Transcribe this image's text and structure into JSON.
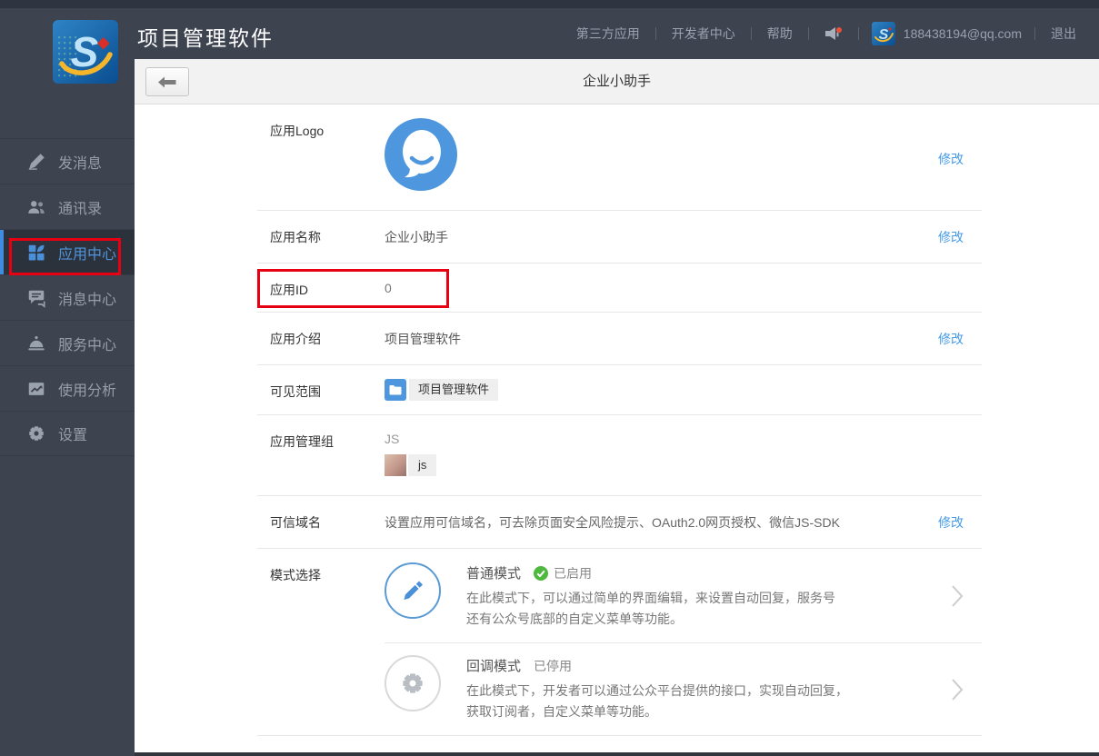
{
  "brand": {
    "app_title": "项目管理软件",
    "logo_letter": "S"
  },
  "topnav": {
    "third_party": "第三方应用",
    "developer_center": "开发者中心",
    "help": "帮助",
    "email": "188438194@qq.com",
    "logout": "退出"
  },
  "sidebar": {
    "items": [
      {
        "label": "发消息",
        "icon": "compose-icon",
        "active": false
      },
      {
        "label": "通讯录",
        "icon": "contacts-icon",
        "active": false
      },
      {
        "label": "应用中心",
        "icon": "apps-icon",
        "active": true,
        "annotation": "red-box"
      },
      {
        "label": "消息中心",
        "icon": "chat-icon",
        "active": false
      },
      {
        "label": "服务中心",
        "icon": "service-bell-icon",
        "active": false
      },
      {
        "label": "使用分析",
        "icon": "analytics-icon",
        "active": false
      },
      {
        "label": "设置",
        "icon": "gear-icon",
        "active": false
      }
    ]
  },
  "page": {
    "title": "企业小助手"
  },
  "form": {
    "logo": {
      "label": "应用Logo",
      "action": "修改"
    },
    "name": {
      "label": "应用名称",
      "value": "企业小助手",
      "action": "修改"
    },
    "app_id": {
      "label": "应用ID",
      "value": "0",
      "annotation": "red-box"
    },
    "intro": {
      "label": "应用介绍",
      "value": "项目管理软件",
      "action": "修改"
    },
    "scope": {
      "label": "可见范围",
      "tag": "项目管理软件"
    },
    "admin_group": {
      "label": "应用管理组",
      "group_name": "JS",
      "member_name": "js"
    },
    "trusted_domain": {
      "label": "可信域名",
      "value": "设置应用可信域名，可去除页面安全风险提示、OAuth2.0网页授权、微信JS-SDK",
      "action": "修改"
    },
    "mode": {
      "label": "模式选择",
      "items": [
        {
          "name": "普通模式",
          "status": "已启用",
          "status_icon": "green-check",
          "desc1": "在此模式下，可以通过简单的界面编辑，来设置自动回复，服务号",
          "desc2": "还有公众号底部的自定义菜单等功能。"
        },
        {
          "name": "回调模式",
          "status": "已停用",
          "desc1": "在此模式下，开发者可以通过公众平台提供的接口，实现自动回复，",
          "desc2": "获取订阅者，自定义菜单等功能。"
        }
      ]
    }
  },
  "colors": {
    "header_dark": "#3d4450",
    "accent_blue": "#4a90d9",
    "link_blue": "#459ae9",
    "status_green": "#4fb83e",
    "annotation_red": "#e60012"
  }
}
